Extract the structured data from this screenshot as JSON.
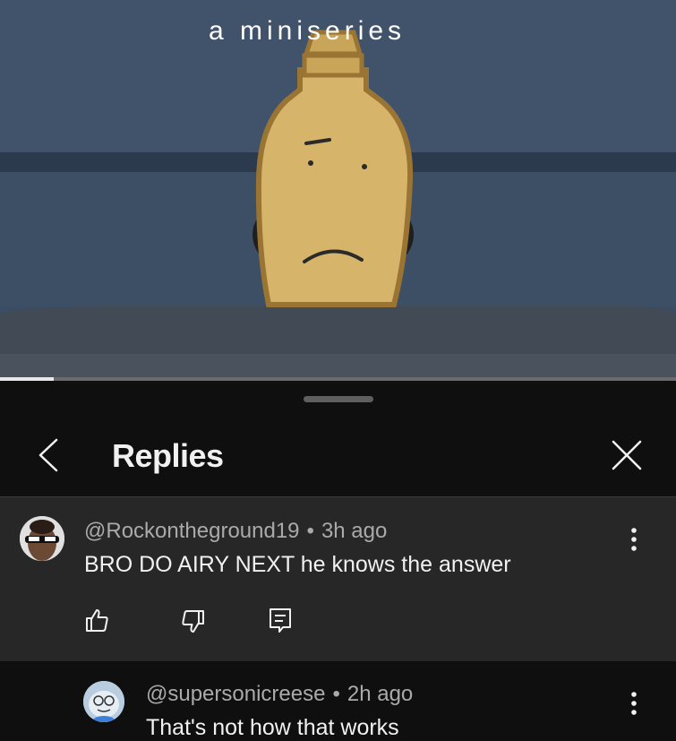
{
  "video": {
    "overlay_text": "a miniseries",
    "progress_fraction": 0.08
  },
  "sheet": {
    "title": "Replies",
    "back_icon": "chevron-left-icon",
    "close_icon": "close-icon"
  },
  "comments": [
    {
      "author": "@Rockontheground19",
      "separator": "•",
      "time": "3h ago",
      "text": "BRO DO AIRY NEXT he knows the answer",
      "actions": [
        "like-icon",
        "dislike-icon",
        "reply-icon"
      ]
    },
    {
      "author": "@supersonicreese",
      "separator": "•",
      "time": "2h ago",
      "text": "That's not how that works"
    }
  ],
  "colors": {
    "sheet_bg": "#0f0f0f",
    "parent_comment_bg": "#272727",
    "text_primary": "#f1f1f1",
    "text_secondary": "#aaaaaa"
  }
}
